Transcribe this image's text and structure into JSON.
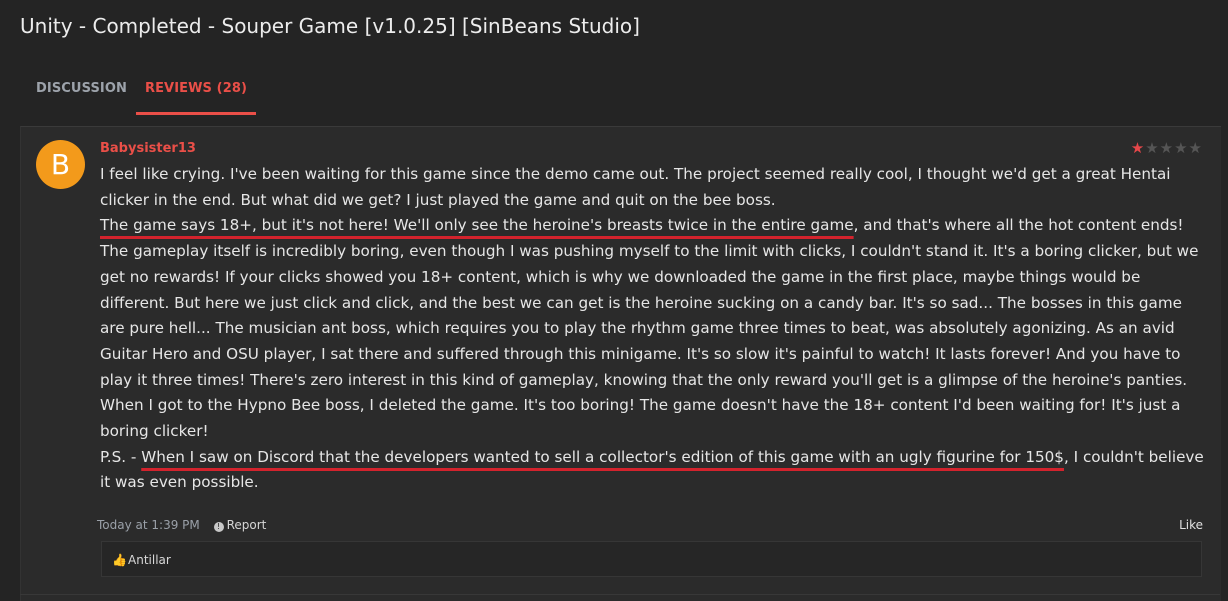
{
  "page": {
    "title": "Unity - Completed - Souper Game [v1.0.25] [SinBeans Studio]"
  },
  "tabs": [
    {
      "label": "DISCUSSION",
      "active": false
    },
    {
      "label": "REVIEWS (28)",
      "active": true
    }
  ],
  "review": {
    "avatar_letter": "B",
    "avatar_color": "#f39a1b",
    "username": "Babysister13",
    "rating": 1,
    "rating_max": 5,
    "body": {
      "p1": "I feel like crying. I've been waiting for this game since the demo came out. The project seemed really cool, I thought we'd get a great Hentai clicker in the end. But what did we get? I just played the game and quit on the bee boss.",
      "p2_underlined": "The game says 18+, but it's not here! We'll only see the heroine's breasts twice in the entire game",
      "p2_rest": ", and that's where all the hot content ends! The gameplay itself is incredibly boring, even though I was pushing myself to the limit with clicks, I couldn't stand it. It's a boring clicker, but we get no rewards! If your clicks showed you 18+ content, which is why we downloaded the game in the first place, maybe things would be different. But here we just click and click, and the best we can get is the heroine sucking on a candy bar. It's so sad... The bosses in this game are pure hell... The musician ant boss, which requires you to play the rhythm game three times to beat, was absolutely agonizing. As an avid Guitar Hero and OSU player, I sat there and suffered through this minigame. It's so slow it's painful to watch! It lasts forever! And you have to play it three times! There's zero interest in this kind of gameplay, knowing that the only reward you'll get is a glimpse of the heroine's panties. When I got to the Hypno Bee boss, I deleted the game. It's too boring! The game doesn't have the 18+ content I'd been waiting for! It's just a boring clicker!",
      "p3_prefix": "P.S. - ",
      "p3_underlined": "When I saw on Discord that the developers wanted to sell a collector's edition of this game with an ugly figurine for 150$",
      "p3_rest": ", I couldn't believe it was even possible."
    },
    "timestamp": "Today at 1:39 PM",
    "report_label": "Report",
    "like_label": "Like",
    "reaction_user": "Antillar"
  },
  "colors": {
    "accent": "#ea4f48",
    "underline_annotation": "#d3232d",
    "star_filled": "#e6474a",
    "star_empty": "#555555"
  },
  "icons": [
    "star-icon",
    "report-icon",
    "thumbs-up-icon"
  ]
}
